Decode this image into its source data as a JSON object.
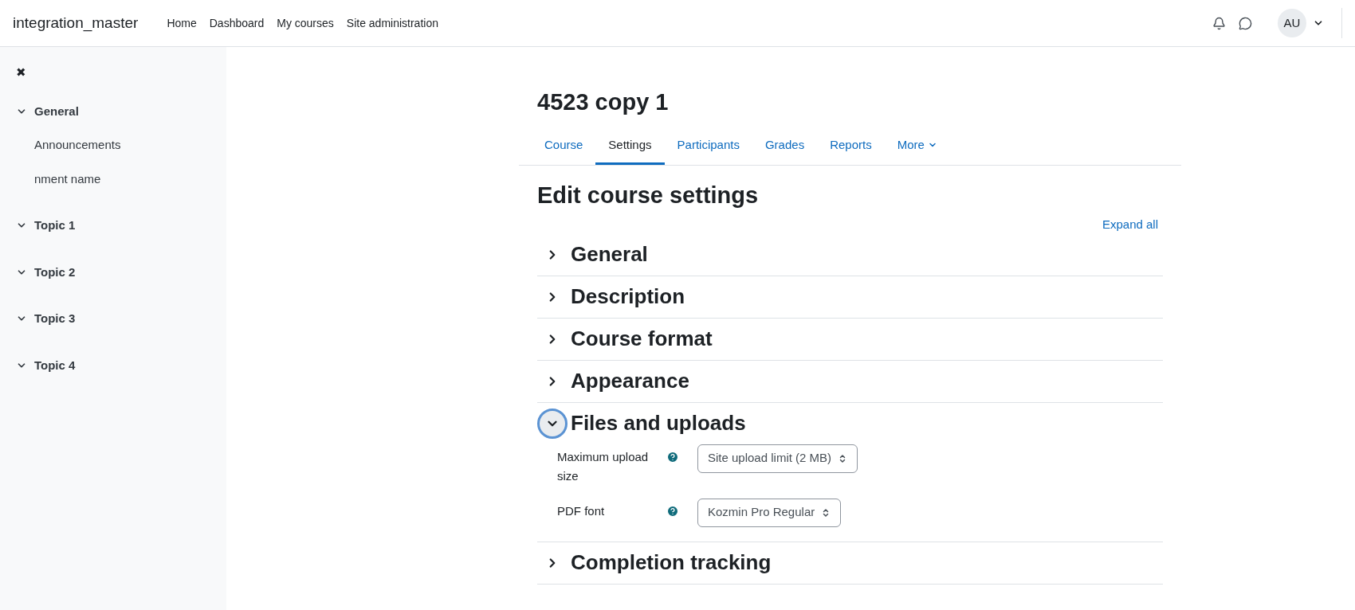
{
  "navbar": {
    "brand": "integration_master",
    "links": [
      "Home",
      "Dashboard",
      "My courses",
      "Site administration"
    ],
    "avatar": "AU"
  },
  "sidebar": {
    "close": "✖",
    "sections": [
      {
        "label": "General",
        "expanded": true,
        "children": [
          "Announcements",
          "nment name"
        ]
      },
      {
        "label": "Topic 1",
        "expanded": true
      },
      {
        "label": "Topic 2",
        "expanded": true
      },
      {
        "label": "Topic 3",
        "expanded": true
      },
      {
        "label": "Topic 4",
        "expanded": true
      }
    ]
  },
  "page": {
    "title": "4523 copy 1",
    "tabs": [
      {
        "label": "Course",
        "selected": false,
        "dropdown": false
      },
      {
        "label": "Settings",
        "selected": true,
        "dropdown": false
      },
      {
        "label": "Participants",
        "selected": false,
        "dropdown": false
      },
      {
        "label": "Grades",
        "selected": false,
        "dropdown": false
      },
      {
        "label": "Reports",
        "selected": false,
        "dropdown": false
      },
      {
        "label": "More",
        "selected": false,
        "dropdown": true
      }
    ],
    "heading": "Edit course settings",
    "expand_all": "Expand all",
    "sections": [
      {
        "label": "General",
        "expanded": false
      },
      {
        "label": "Description",
        "expanded": false
      },
      {
        "label": "Course format",
        "expanded": false
      },
      {
        "label": "Appearance",
        "expanded": false
      },
      {
        "label": "Files and uploads",
        "expanded": true,
        "fields": [
          {
            "label": "Maximum upload size",
            "value": "Site upload limit (2 MB)"
          },
          {
            "label": "PDF font",
            "value": "Kozmin Pro Regular"
          }
        ]
      },
      {
        "label": "Completion tracking",
        "expanded": false
      }
    ]
  }
}
